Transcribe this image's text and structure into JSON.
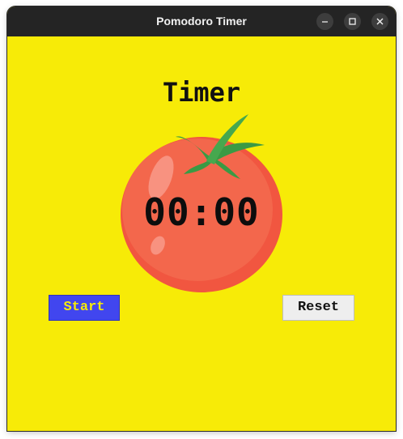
{
  "window": {
    "title": "Pomodoro Timer",
    "controls": [
      "minimize-icon",
      "maximize-icon",
      "close-icon"
    ]
  },
  "main": {
    "heading": "Timer",
    "time": "00:00",
    "image": "tomato"
  },
  "buttons": {
    "start_label": "Start",
    "reset_label": "Reset"
  },
  "colors": {
    "background": "#f7eb07",
    "start_button": "#4146ef",
    "start_text": "#f7eb07",
    "reset_button": "#eeeeee",
    "titlebar": "#242424"
  }
}
